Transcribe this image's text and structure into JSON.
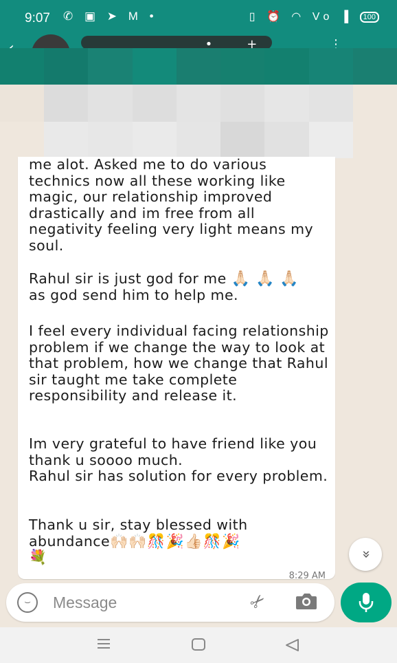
{
  "status_bar": {
    "time": "9:07",
    "left_icons": "✆ ▣ ➤ M •",
    "right_icons": "▯ ⏰ ◠ Vo ▐",
    "battery": "100"
  },
  "chat_header": {
    "contact_name": "",
    "actions": "•+ ⋮"
  },
  "message": {
    "paragraphs": {
      "p1": "me alot. Asked me to do various technics now all these working like magic, our relationship improved drastically and im free from all negativity feeling very light means my soul.",
      "p2a": "Rahul sir is just god for me",
      "p2_emoji": "🙏🏻🙏🏻🙏🏻",
      "p2b": "as god send him to help me.",
      "p3": "I feel every individual facing relationship problem if we change the way to look at that problem, how we change that Rahul sir taught me take complete responsibility and release it.",
      "p4a": "Im very grateful to have friend like you thank u soooo much.",
      "p4b": "Rahul sir has solution for every problem.",
      "p5a": "Thank u sir, stay blessed with",
      "p5b": "abundance",
      "p5_emoji": "🙌🏻🙌🏻🎊🎉👍🏻🎊🎉",
      "p6_emoji": "💐"
    },
    "timestamp": "8:29 AM"
  },
  "scroll_button": {
    "icon": "chevron-double-down-icon",
    "glyph": "«"
  },
  "composer": {
    "placeholder": "Message",
    "value": ""
  },
  "colors": {
    "header": "#128c7e",
    "background": "#efe7dd",
    "bubble": "#ffffff",
    "mic_button": "#00a884"
  }
}
